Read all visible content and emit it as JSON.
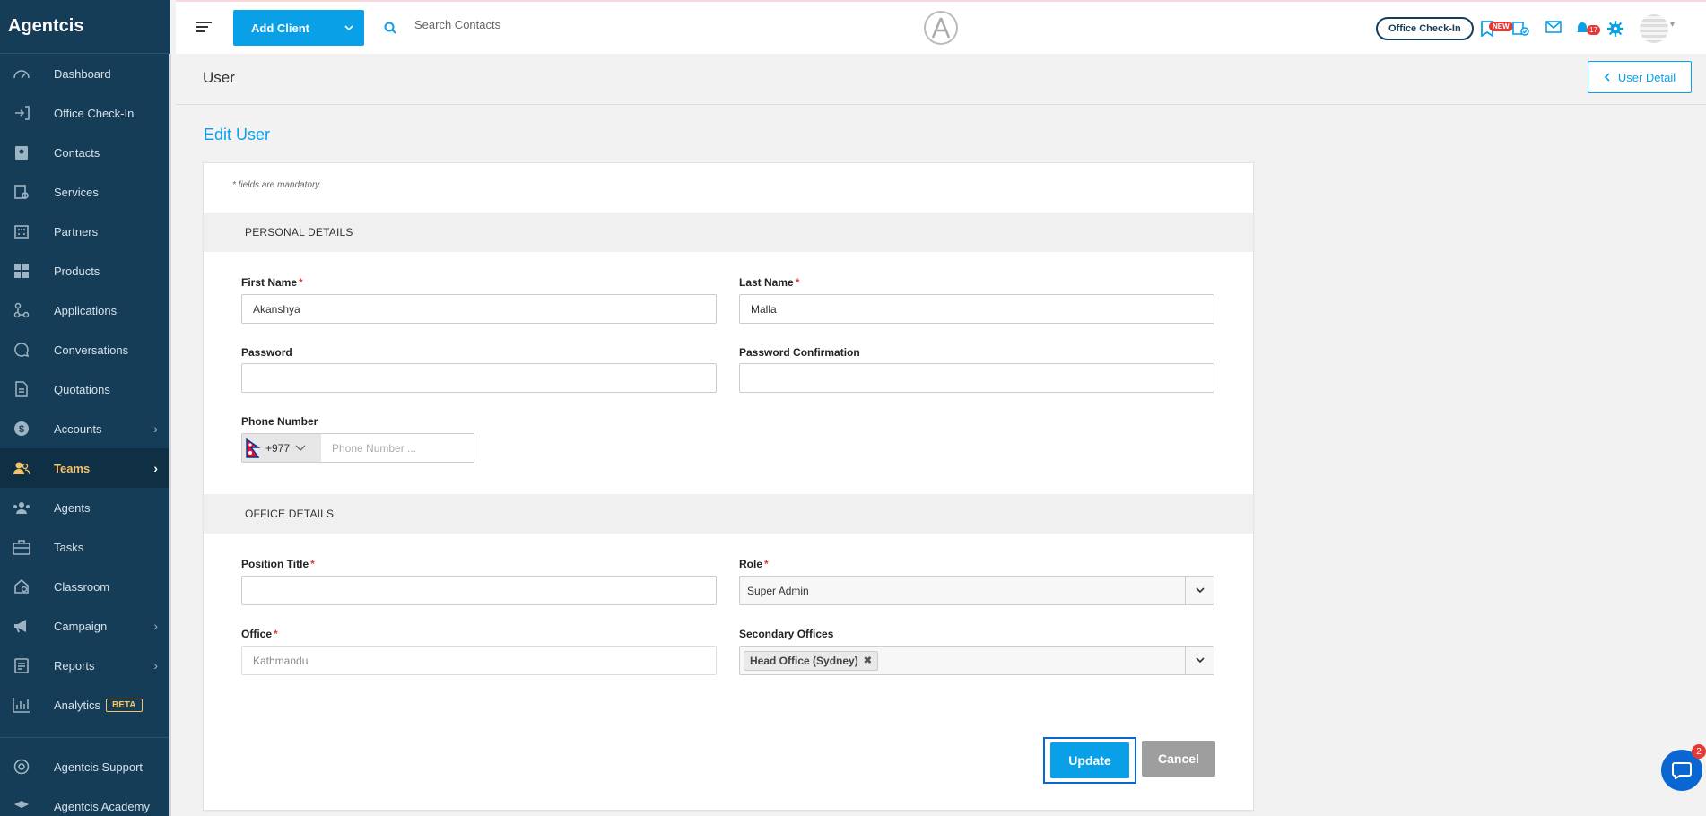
{
  "app": {
    "name": "Agentcis"
  },
  "sidebar": {
    "items": [
      {
        "label": "Dashboard",
        "icon": "gauge-icon"
      },
      {
        "label": "Office Check-In",
        "icon": "checkin-icon"
      },
      {
        "label": "Contacts",
        "icon": "contacts-icon"
      },
      {
        "label": "Services",
        "icon": "services-icon"
      },
      {
        "label": "Partners",
        "icon": "building-icon"
      },
      {
        "label": "Products",
        "icon": "grid-icon"
      },
      {
        "label": "Applications",
        "icon": "flow-icon"
      },
      {
        "label": "Conversations",
        "icon": "chat-icon"
      },
      {
        "label": "Quotations",
        "icon": "document-icon"
      },
      {
        "label": "Accounts",
        "icon": "dollar-icon"
      },
      {
        "label": "Teams",
        "icon": "team-icon"
      },
      {
        "label": "Agents",
        "icon": "agents-icon"
      },
      {
        "label": "Tasks",
        "icon": "briefcase-icon"
      },
      {
        "label": "Classroom",
        "icon": "classroom-icon"
      },
      {
        "label": "Campaign",
        "icon": "megaphone-icon"
      },
      {
        "label": "Reports",
        "icon": "clipboard-icon"
      },
      {
        "label": "Analytics",
        "icon": "chart-icon",
        "badge": "BETA"
      }
    ],
    "active": "Teams",
    "footer": [
      {
        "label": "Agentcis Support",
        "icon": "lifebuoy-icon"
      },
      {
        "label": "Agentcis Academy",
        "icon": "academy-icon"
      }
    ]
  },
  "topbar": {
    "add_client_label": "Add Client",
    "search_placeholder": "Search Contacts",
    "office_checkin_label": "Office Check-In",
    "new_badge": "NEW",
    "notification_count": "17"
  },
  "page": {
    "title": "User",
    "user_detail_label": "User Detail",
    "edit_title": "Edit User",
    "mandatory_note": "* fields are mandatory."
  },
  "form": {
    "personal_section": "PERSONAL DETAILS",
    "office_section": "OFFICE DETAILS",
    "first_name": {
      "label": "First Name",
      "value": "Akanshya"
    },
    "last_name": {
      "label": "Last Name",
      "value": "Malla"
    },
    "password": {
      "label": "Password",
      "value": ""
    },
    "password_confirmation": {
      "label": "Password Confirmation",
      "value": ""
    },
    "phone": {
      "label": "Phone Number",
      "code": "+977",
      "placeholder": "Phone Number ..."
    },
    "position_title": {
      "label": "Position Title",
      "value": ""
    },
    "role": {
      "label": "Role",
      "value": "Super Admin"
    },
    "office": {
      "label": "Office",
      "value": "Kathmandu"
    },
    "secondary_offices": {
      "label": "Secondary Offices",
      "selected": [
        "Head Office (Sydney)"
      ]
    },
    "update_label": "Update",
    "cancel_label": "Cancel"
  },
  "chat": {
    "badge": "2"
  },
  "colors": {
    "accent": "#0aa0e8",
    "sidebar": "#163d57",
    "active": "#f5c266",
    "required": "#e53935"
  }
}
